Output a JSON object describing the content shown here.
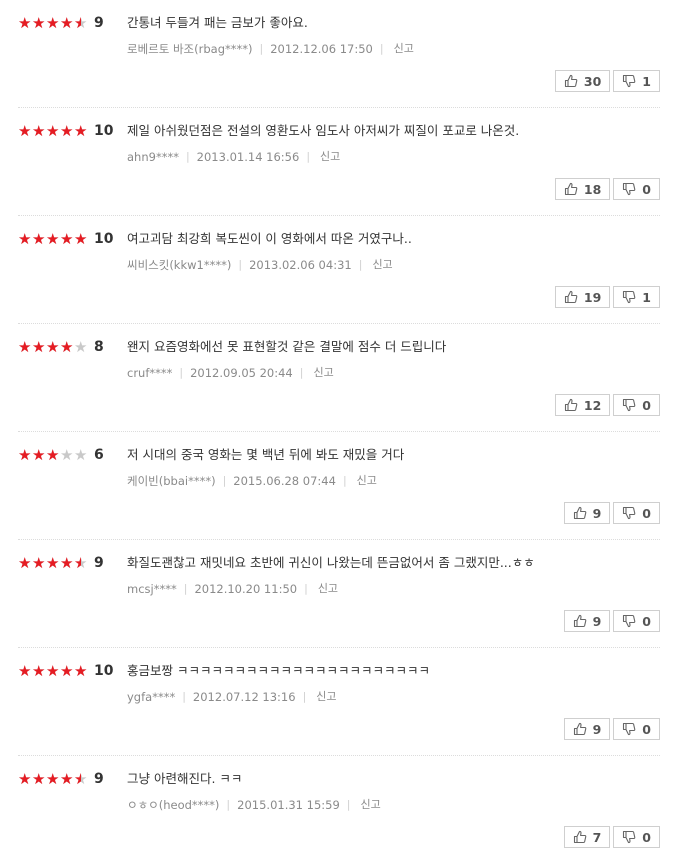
{
  "colors": {
    "star_on": "#e51c23",
    "star_off": "#c9c9c9"
  },
  "icons": {
    "star": "star-icon",
    "like": "thumbs-up-icon",
    "dislike": "thumbs-down-icon"
  },
  "report_label": "신고",
  "reviews": [
    {
      "rating": 9,
      "score": "9",
      "comment": "간통녀 두들겨 패는 금보가 좋아요.",
      "user": "로베르토 바조(rbag****)",
      "date": "2012.12.06 17:50",
      "likes": "30",
      "dislikes": "1"
    },
    {
      "rating": 10,
      "score": "10",
      "comment": "제일 아쉬웠던점은 전설의 영환도사 임도사 아저씨가 찌질이 포교로 나온것.",
      "user": "ahn9****",
      "date": "2013.01.14 16:56",
      "likes": "18",
      "dislikes": "0"
    },
    {
      "rating": 10,
      "score": "10",
      "comment": "여고괴담 최강희 복도씬이 이 영화에서 따온 거였구나..",
      "user": "씨비스킷(kkw1****)",
      "date": "2013.02.06 04:31",
      "likes": "19",
      "dislikes": "1"
    },
    {
      "rating": 8,
      "score": "8",
      "comment": "왠지 요즘영화에선 못 표현할것 같은 결말에 점수 더 드립니다",
      "user": "cruf****",
      "date": "2012.09.05 20:44",
      "likes": "12",
      "dislikes": "0"
    },
    {
      "rating": 6,
      "score": "6",
      "comment": "저 시대의 중국 영화는 몇 백년 뒤에 봐도 재밌을 거다",
      "user": "케이빈(bbai****)",
      "date": "2015.06.28 07:44",
      "likes": "9",
      "dislikes": "0"
    },
    {
      "rating": 9,
      "score": "9",
      "comment": "화질도괜찮고 재밋네요 초반에 귀신이 나왔는데 뜬금없어서 좀 그랬지만...ㅎㅎ",
      "user": "mcsj****",
      "date": "2012.10.20 11:50",
      "likes": "9",
      "dislikes": "0"
    },
    {
      "rating": 10,
      "score": "10",
      "comment": "홍금보짱 ㅋㅋㅋㅋㅋㅋㅋㅋㅋㅋㅋㅋㅋㅋㅋㅋㅋㅋㅋㅋㅋㅋ",
      "user": "ygfa****",
      "date": "2012.07.12 13:16",
      "likes": "9",
      "dislikes": "0"
    },
    {
      "rating": 9,
      "score": "9",
      "comment": "그냥 아련해진다. ㅋㅋ",
      "user": "ㅇㅎㅇ(heod****)",
      "date": "2015.01.31 15:59",
      "likes": "7",
      "dislikes": "0"
    }
  ]
}
